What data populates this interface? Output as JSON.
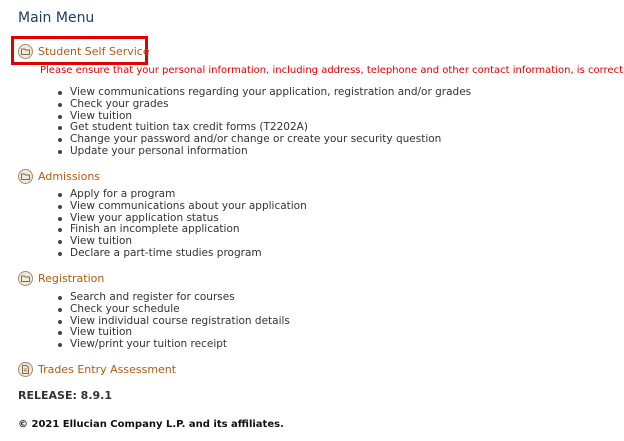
{
  "page": {
    "title": "Main Menu"
  },
  "sections": [
    {
      "label": "Student Self Service",
      "icon": "folder-icon",
      "notice": "Please ensure that your personal information, including address, telephone and other contact information, is correct.",
      "items": [
        "View communications regarding your application, registration and/or grades",
        "Check your grades",
        "View tuition",
        "Get student tuition tax credit forms (T2202A)",
        "Change your password and/or change or create your security question",
        "Update your personal information"
      ]
    },
    {
      "label": "Admissions",
      "icon": "folder-icon",
      "items": [
        "Apply for a program",
        "View communications about your application",
        "View your application status",
        "Finish an incomplete application",
        "View tuition",
        "Declare a part-time studies program"
      ]
    },
    {
      "label": "Registration",
      "icon": "folder-icon",
      "items": [
        "Search and register for courses",
        "Check your schedule",
        "View individual course registration details",
        "View tuition",
        "View/print your tuition receipt"
      ]
    },
    {
      "label": "Trades Entry Assessment",
      "icon": "document-icon",
      "items": []
    }
  ],
  "release": "RELEASE: 8.9.1",
  "copyright": "© 2021 Ellucian Company L.P. and its affiliates.",
  "colors": {
    "link": "#b05a10",
    "notice": "#e00000",
    "highlight": "#e00000",
    "title": "#1e3a5f"
  }
}
